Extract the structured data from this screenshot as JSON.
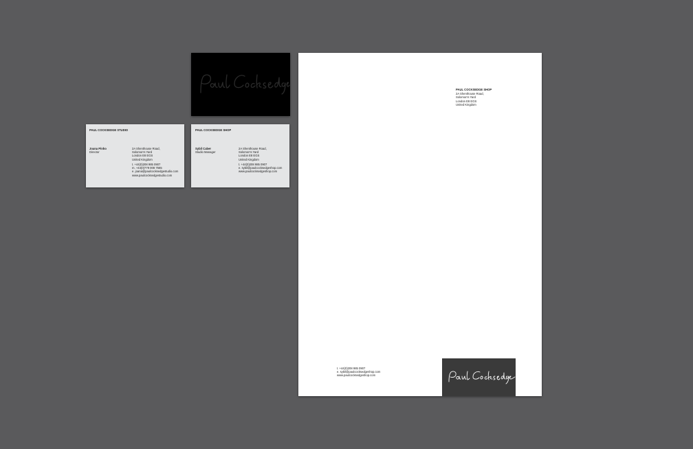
{
  "black_card": {
    "signature": "Paul Cocksedge"
  },
  "studio_card": {
    "company": "PAUL COCKSEDGE STUDIO",
    "person_name": "Joana Pinho",
    "person_title": "Director",
    "address": [
      "2A Shenthouse Road,",
      "Solomon's Yard",
      "London E8 EGS",
      "United Kingdom"
    ],
    "contacts": [
      "t. +44(0)208 985 0907",
      "m. +44(0)779 008 7565",
      "e. joana@paulcocksedgestudio.com",
      "www.paulcocksedgestudio.com"
    ]
  },
  "shop_card": {
    "company": "PAUL COCKSEDGE SHOP",
    "person_name": "Sybil Caber",
    "person_title": "Studio Manager",
    "address": [
      "2A Shenthouse Road,",
      "Solomon's Yard",
      "London E8 EGS",
      "United Kingdom"
    ],
    "contacts": [
      "t. +44(0)208 985 0907",
      "e. sybil@paulcocksedgeshop.com",
      "www.paulcocksedgeshop.com"
    ]
  },
  "letterhead": {
    "company": "PAUL COCKSEDGE SHOP",
    "address": [
      "2A Shenthouse Road,",
      "Solomon's Yard",
      "London E8 EGS",
      "United Kingdom"
    ],
    "contacts": [
      "t. +44(0)208 985 0907",
      "e. sybil@paulcocksedgeshop.com",
      "www.paulcocksedgeshop.com"
    ],
    "signature": "Paul Cocksedge"
  },
  "colors": {
    "background": "#5a5a5c",
    "card_grey": "#e4e5e6",
    "logo_box": "#3a3a3a"
  }
}
